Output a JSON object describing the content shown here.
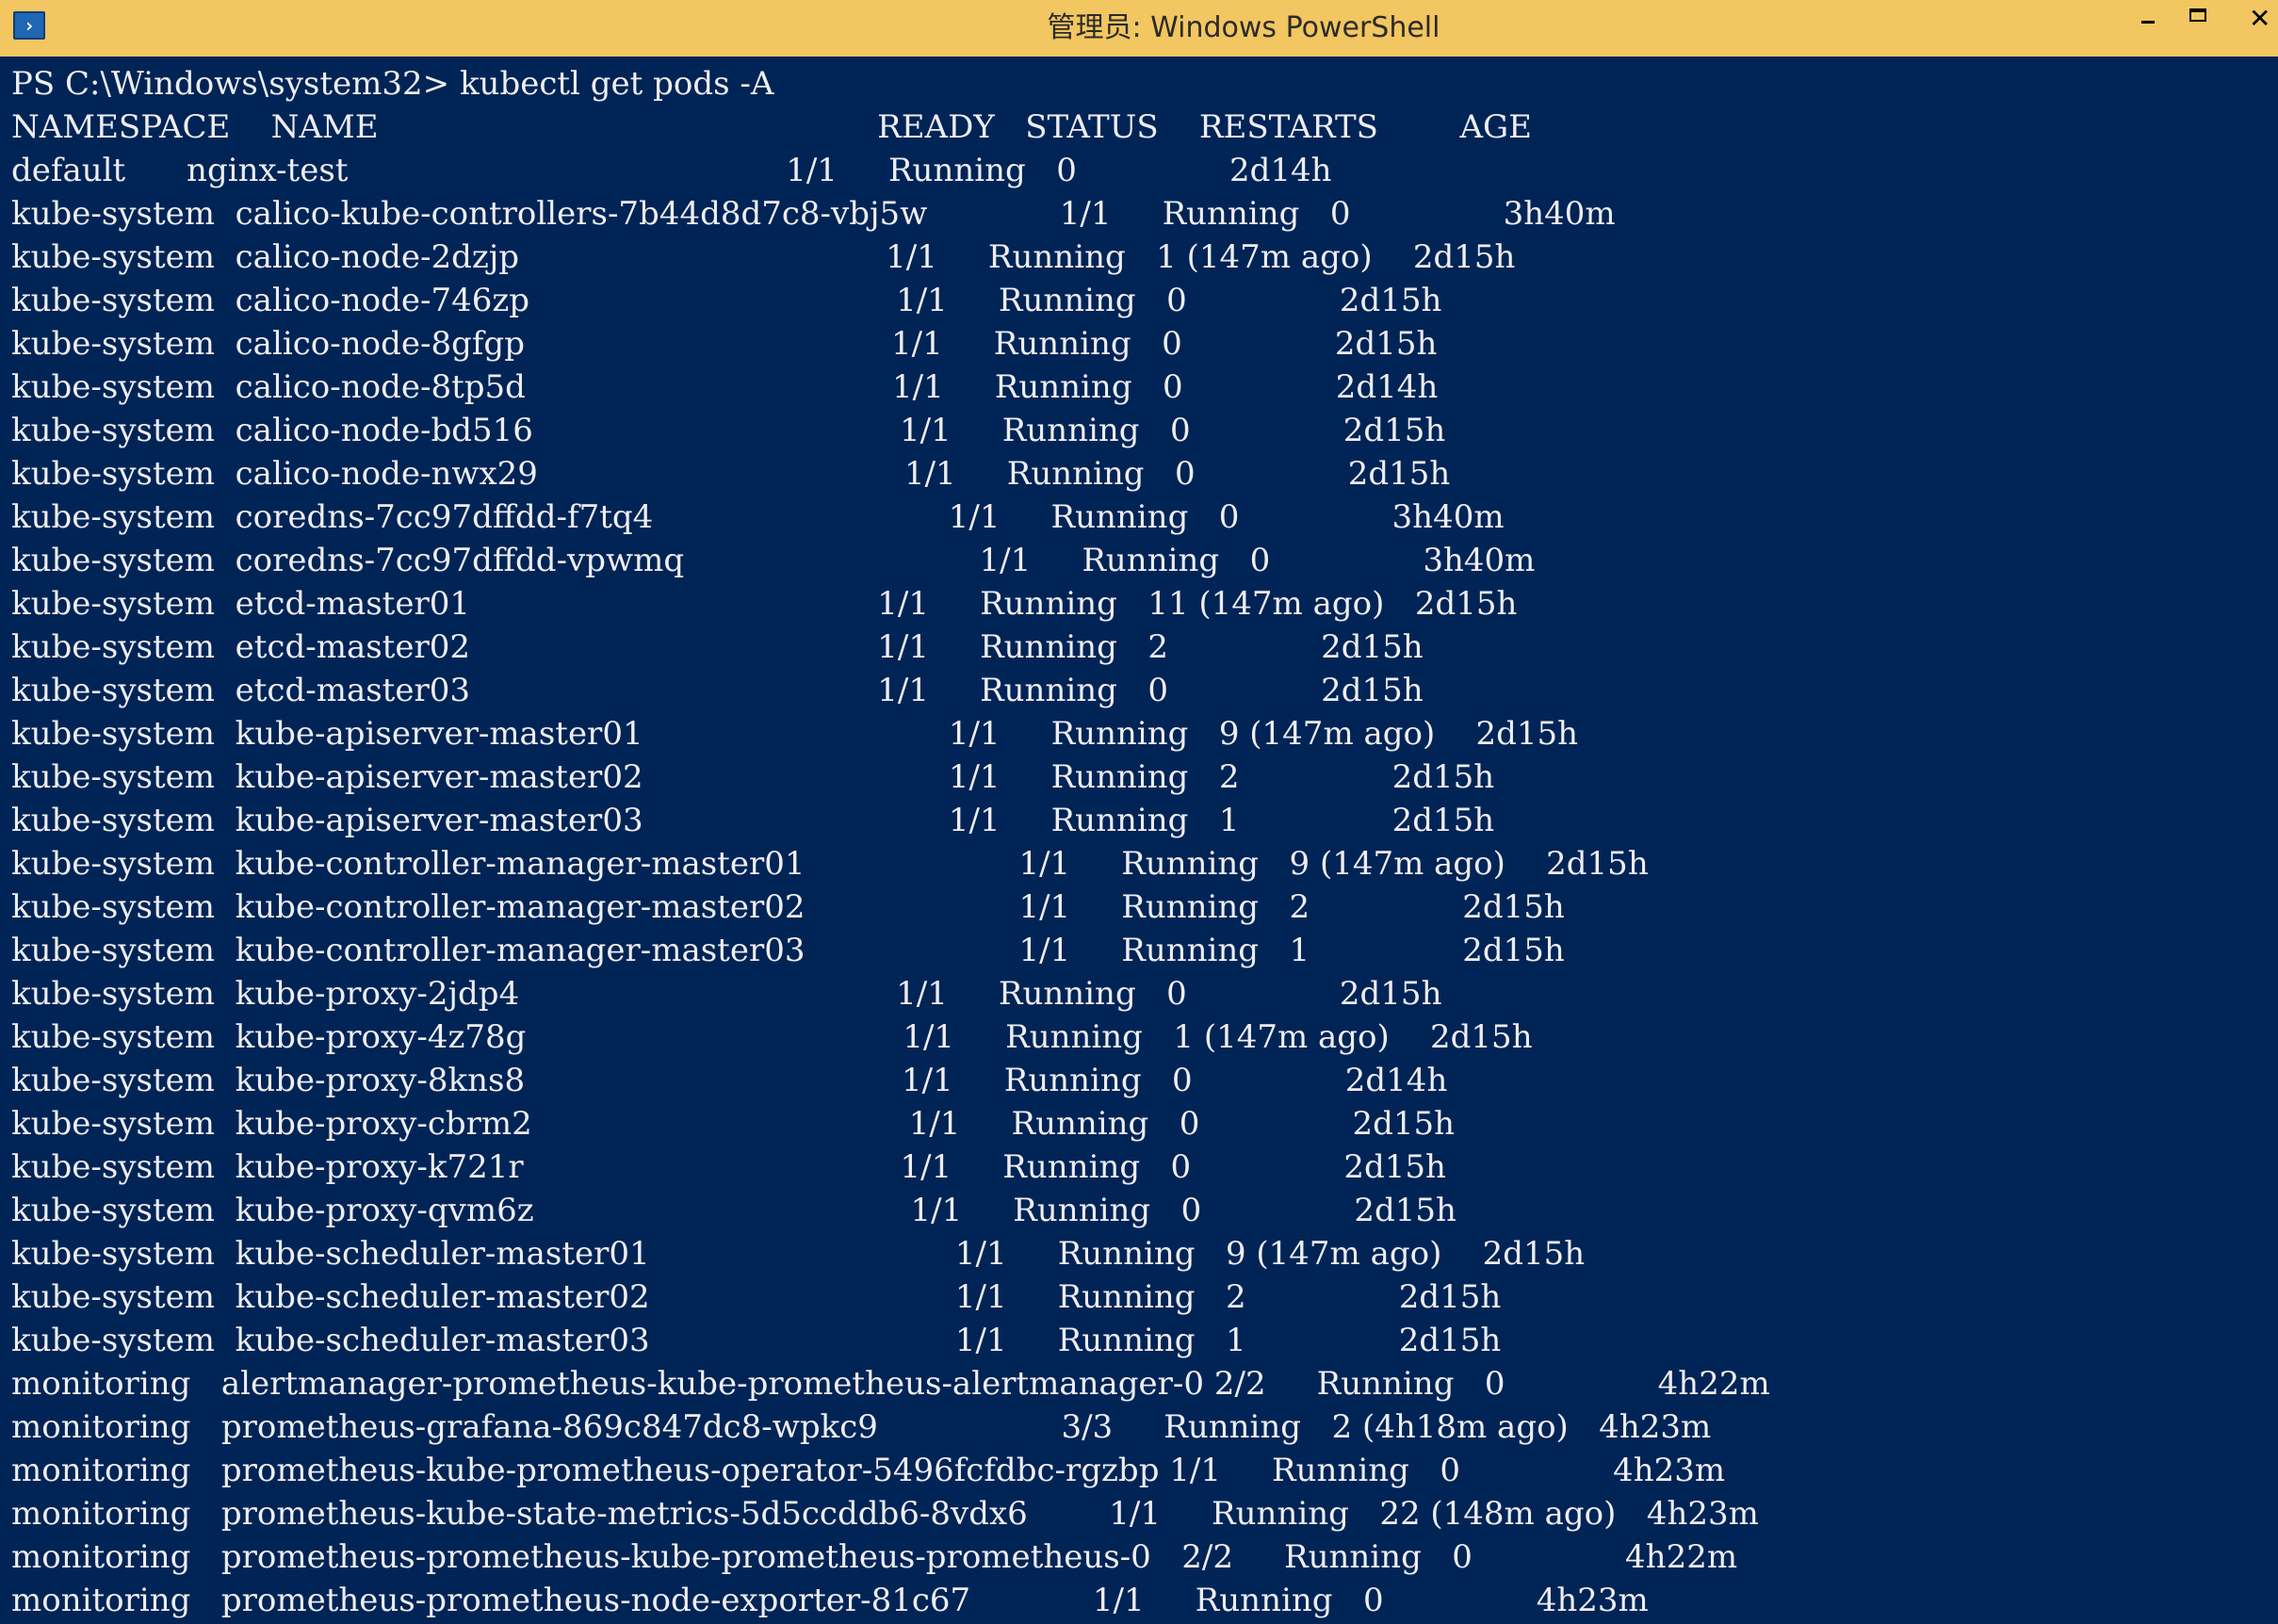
{
  "window": {
    "title": "管理员: Windows PowerShell",
    "icon": "powershell-icon",
    "controls": [
      "minimize-icon",
      "maximize-icon",
      "close-icon"
    ]
  },
  "console": {
    "prompt": "PS C:\\Windows\\system32> ",
    "command": "kubectl get pods -A",
    "background": "#012456",
    "foreground": "#eeedf0",
    "columns": [
      "NAMESPACE",
      "NAME",
      "READY",
      "STATUS",
      "RESTARTS",
      "AGE"
    ],
    "rows": [
      [
        "default",
        "nginx-test",
        "1/1",
        "Running",
        "0",
        "2d14h"
      ],
      [
        "kube-system",
        "calico-kube-controllers-7b44d8d7c8-vbj5w",
        "1/1",
        "Running",
        "0",
        "3h40m"
      ],
      [
        "kube-system",
        "calico-node-2dzjp",
        "1/1",
        "Running",
        "1 (147m ago)",
        "2d15h"
      ],
      [
        "kube-system",
        "calico-node-746zp",
        "1/1",
        "Running",
        "0",
        "2d15h"
      ],
      [
        "kube-system",
        "calico-node-8gfgp",
        "1/1",
        "Running",
        "0",
        "2d15h"
      ],
      [
        "kube-system",
        "calico-node-8tp5d",
        "1/1",
        "Running",
        "0",
        "2d14h"
      ],
      [
        "kube-system",
        "calico-node-bd516",
        "1/1",
        "Running",
        "0",
        "2d15h"
      ],
      [
        "kube-system",
        "calico-node-nwx29",
        "1/1",
        "Running",
        "0",
        "2d15h"
      ],
      [
        "kube-system",
        "coredns-7cc97dffdd-f7tq4",
        "1/1",
        "Running",
        "0",
        "3h40m"
      ],
      [
        "kube-system",
        "coredns-7cc97dffdd-vpwmq",
        "1/1",
        "Running",
        "0",
        "3h40m"
      ],
      [
        "kube-system",
        "etcd-master01",
        "1/1",
        "Running",
        "11 (147m ago)",
        "2d15h"
      ],
      [
        "kube-system",
        "etcd-master02",
        "1/1",
        "Running",
        "2",
        "2d15h"
      ],
      [
        "kube-system",
        "etcd-master03",
        "1/1",
        "Running",
        "0",
        "2d15h"
      ],
      [
        "kube-system",
        "kube-apiserver-master01",
        "1/1",
        "Running",
        "9 (147m ago)",
        "2d15h"
      ],
      [
        "kube-system",
        "kube-apiserver-master02",
        "1/1",
        "Running",
        "2",
        "2d15h"
      ],
      [
        "kube-system",
        "kube-apiserver-master03",
        "1/1",
        "Running",
        "1",
        "2d15h"
      ],
      [
        "kube-system",
        "kube-controller-manager-master01",
        "1/1",
        "Running",
        "9 (147m ago)",
        "2d15h"
      ],
      [
        "kube-system",
        "kube-controller-manager-master02",
        "1/1",
        "Running",
        "2",
        "2d15h"
      ],
      [
        "kube-system",
        "kube-controller-manager-master03",
        "1/1",
        "Running",
        "1",
        "2d15h"
      ],
      [
        "kube-system",
        "kube-proxy-2jdp4",
        "1/1",
        "Running",
        "0",
        "2d15h"
      ],
      [
        "kube-system",
        "kube-proxy-4z78g",
        "1/1",
        "Running",
        "1 (147m ago)",
        "2d15h"
      ],
      [
        "kube-system",
        "kube-proxy-8kns8",
        "1/1",
        "Running",
        "0",
        "2d14h"
      ],
      [
        "kube-system",
        "kube-proxy-cbrm2",
        "1/1",
        "Running",
        "0",
        "2d15h"
      ],
      [
        "kube-system",
        "kube-proxy-k721r",
        "1/1",
        "Running",
        "0",
        "2d15h"
      ],
      [
        "kube-system",
        "kube-proxy-qvm6z",
        "1/1",
        "Running",
        "0",
        "2d15h"
      ],
      [
        "kube-system",
        "kube-scheduler-master01",
        "1/1",
        "Running",
        "9 (147m ago)",
        "2d15h"
      ],
      [
        "kube-system",
        "kube-scheduler-master02",
        "1/1",
        "Running",
        "2",
        "2d15h"
      ],
      [
        "kube-system",
        "kube-scheduler-master03",
        "1/1",
        "Running",
        "1",
        "2d15h"
      ],
      [
        "monitoring",
        "alertmanager-prometheus-kube-prometheus-alertmanager-0",
        "2/2",
        "Running",
        "0",
        "4h22m"
      ],
      [
        "monitoring",
        "prometheus-grafana-869c847dc8-wpkc9",
        "3/3",
        "Running",
        "2 (4h18m ago)",
        "4h23m"
      ],
      [
        "monitoring",
        "prometheus-kube-prometheus-operator-5496fcfdbc-rgzbp",
        "1/1",
        "Running",
        "0",
        "4h23m"
      ],
      [
        "monitoring",
        "prometheus-kube-state-metrics-5d5ccddb6-8vdx6",
        "1/1",
        "Running",
        "22 (148m ago)",
        "4h23m"
      ],
      [
        "monitoring",
        "prometheus-prometheus-kube-prometheus-prometheus-0",
        "2/2",
        "Running",
        "0",
        "4h22m"
      ],
      [
        "monitoring",
        "prometheus-prometheus-node-exporter-81c67",
        "1/1",
        "Running",
        "0",
        "4h23m"
      ]
    ]
  }
}
